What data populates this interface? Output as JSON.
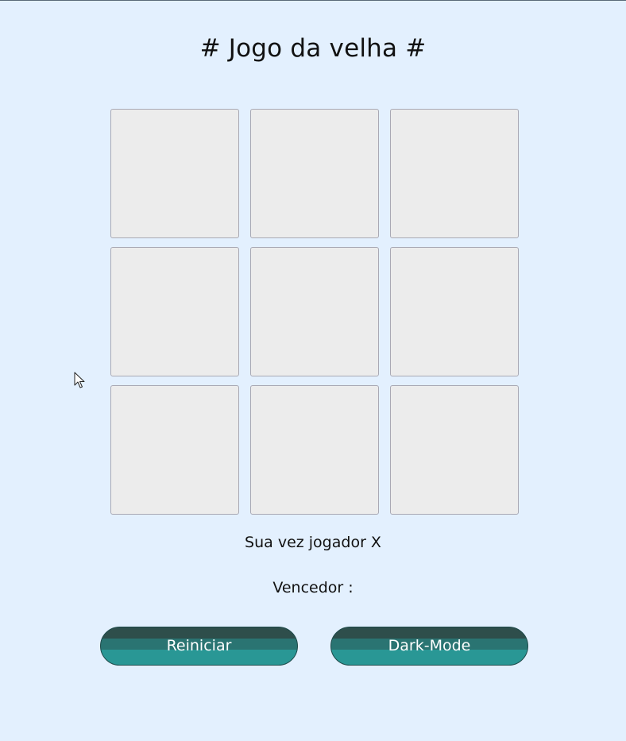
{
  "title": "# Jogo da velha #",
  "board": {
    "cells": [
      "",
      "",
      "",
      "",
      "",
      "",
      "",
      "",
      ""
    ]
  },
  "status": {
    "turn": "Sua vez jogador X",
    "winner": "Vencedor :"
  },
  "buttons": {
    "restart": "Reiniciar",
    "dark_mode": "Dark-Mode"
  },
  "colors": {
    "background": "#e3f0fe",
    "cell": "#ececec",
    "button_dark": "#2e4e4b",
    "button_teal": "#299795"
  },
  "icons": {
    "cursor": "mouse-pointer-icon"
  }
}
